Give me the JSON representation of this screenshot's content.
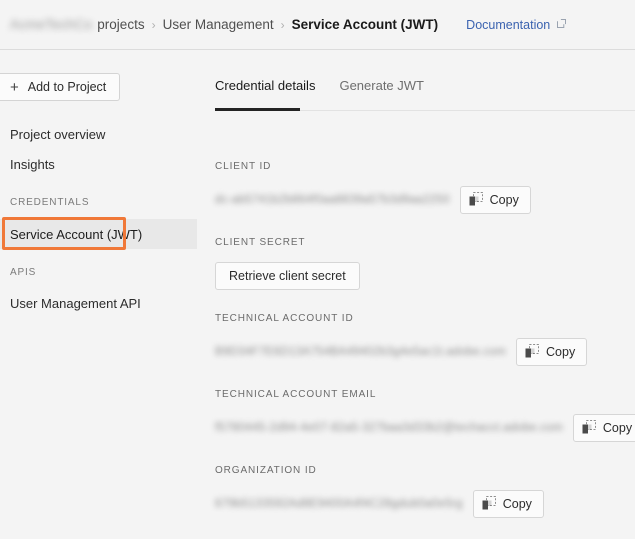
{
  "breadcrumb": {
    "org_redacted": "AcmeTechCo",
    "projects_label": "projects",
    "separator": "›",
    "section_label": "User Management",
    "current_label": "Service Account (JWT)",
    "documentation_label": "Documentation",
    "documentation_icon": "external-link-icon"
  },
  "sidebar": {
    "add_button": {
      "label": "Add to Project",
      "icon": "plus-icon"
    },
    "links": [
      {
        "label": "Project overview"
      },
      {
        "label": "Insights"
      }
    ],
    "credentials_heading": "CREDENTIALS",
    "selected_item": "Service Account (JWT)",
    "apis_heading": "APIS",
    "api_item": "User Management API",
    "highlight_color": "#f07838",
    "selected_row_color": "#e8e8e8"
  },
  "main": {
    "tabs": [
      {
        "label": "Credential details",
        "active": true
      },
      {
        "label": "Generate JWT",
        "active": false
      }
    ],
    "fields": [
      {
        "label": "CLIENT ID",
        "value_redacted": "dc-ab5741b2b864f0aa8839a57b3d9aa2250",
        "action": "Copy",
        "action_icon": "copy-icon"
      },
      {
        "label": "CLIENT SECRET",
        "value_redacted": "",
        "action": "Retrieve client secret",
        "action_icon": ""
      },
      {
        "label": "TECHNICAL ACCOUNT ID",
        "value_redacted": "B9D34F7E6D13A754BA49402b3g4e5ac1t.adobe.com",
        "action": "Copy",
        "action_icon": "copy-icon"
      },
      {
        "label": "TECHNICAL ACCOUNT EMAIL",
        "value_redacted": "f5780445-2d94-4e07-82a5-327baa3d33b2@techacct.adobe.com",
        "action": "Copy",
        "action_icon": "copy-icon"
      },
      {
        "label": "ORGANIZATION ID",
        "value_redacted": "679b5133592Ad8E9400A4f4C28gdub0a0e5rg",
        "action": "Copy",
        "action_icon": "copy-icon"
      }
    ]
  }
}
